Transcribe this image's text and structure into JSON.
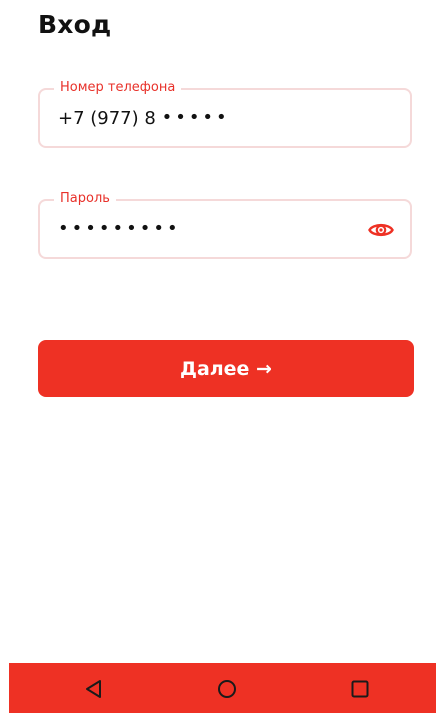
{
  "screen": {
    "title": "Вход"
  },
  "phone_field": {
    "label": "Номер телефона",
    "value_visible": "+7 (977) 8",
    "value_masked": "•••••"
  },
  "password_field": {
    "label": "Пароль",
    "value_masked": "•••••••••",
    "toggle_icon": "eye-icon"
  },
  "next_button": {
    "label": "Далее →"
  },
  "nav_bar": {
    "items": [
      "back-icon",
      "home-icon",
      "recents-icon"
    ]
  },
  "colors": {
    "accent": "#ee3124",
    "label_red": "#e8312a",
    "field_border": "#f5d9d9",
    "text": "#111111",
    "background": "#ffffff"
  }
}
